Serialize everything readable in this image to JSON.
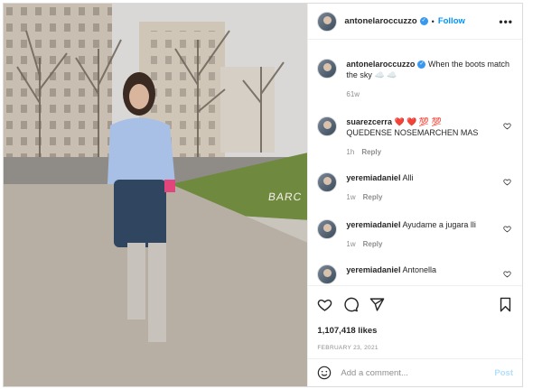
{
  "post": {
    "username": "antonelaroccuzzo",
    "follow_label": "Follow",
    "more_label": "•••",
    "dot": "•",
    "caption": "When the boots match the sky",
    "caption_emoji": "☁️ ☁️",
    "caption_age": "61w",
    "likes": "1,107,418 likes",
    "date": "FEBRUARY 23, 2021",
    "photo_sign": "BARC",
    "add_comment_placeholder": "Add a comment...",
    "post_label": "Post"
  },
  "comments": [
    {
      "username": "suarezcerra",
      "emoji": "❤️ ❤️ 💯 💯",
      "text": "QUEDENSE NOSEMARCHEN MAS",
      "age": "1h",
      "reply": "Reply"
    },
    {
      "username": "yeremiadaniel",
      "text": "Alli",
      "age": "1w",
      "reply": "Reply"
    },
    {
      "username": "yeremiadaniel",
      "text": "Ayudame a jugara lli",
      "age": "1w",
      "reply": "Reply"
    },
    {
      "username": "yeremiadaniel",
      "text": "Antonella",
      "age": "",
      "reply": ""
    }
  ],
  "colors": {
    "accent": "#0095f6",
    "verified": "#3897f0",
    "muted": "#8e8e8e",
    "heart": "#ed4956"
  },
  "icons": [
    "more-icon",
    "verified-icon",
    "heart-icon",
    "comment-icon",
    "share-icon",
    "bookmark-icon",
    "emoji-icon"
  ]
}
